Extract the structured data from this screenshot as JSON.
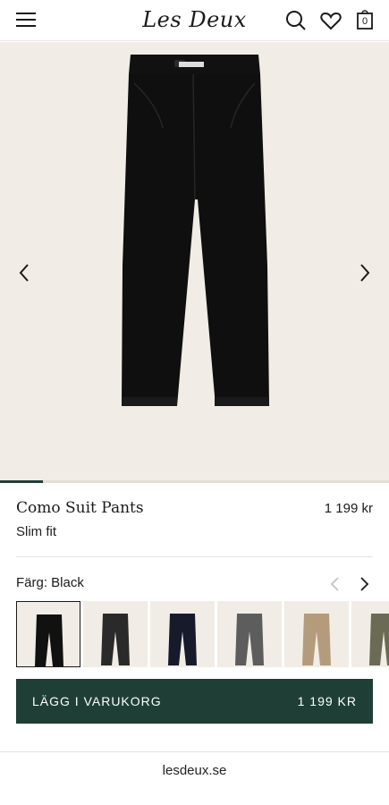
{
  "header": {
    "logo": "Les Deux",
    "cart_count": "0"
  },
  "gallery": {
    "image_alt": "Como Suit Pants black",
    "progress": 0.11
  },
  "product": {
    "title": "Como Suit Pants",
    "price": "1 199 kr",
    "fit": "Slim fit"
  },
  "color": {
    "label": "Färg: Black",
    "swatches": [
      {
        "name": "Black",
        "hex": "#111111",
        "selected": true
      },
      {
        "name": "Dark Charcoal",
        "hex": "#2a2a2a",
        "selected": false
      },
      {
        "name": "Navy",
        "hex": "#161a2b",
        "selected": false
      },
      {
        "name": "Grey",
        "hex": "#5d5d5d",
        "selected": false
      },
      {
        "name": "Beige",
        "hex": "#b49b7c",
        "selected": false
      },
      {
        "name": "Olive",
        "hex": "#6b6a55",
        "selected": false
      }
    ]
  },
  "cart_button": {
    "label": "LÄGG I VARUKORG",
    "price": "1 199 KR"
  },
  "footer": {
    "url": "lesdeux.se"
  },
  "colors": {
    "accent": "#1f3e36",
    "gallery_bg": "#f1ede6"
  }
}
